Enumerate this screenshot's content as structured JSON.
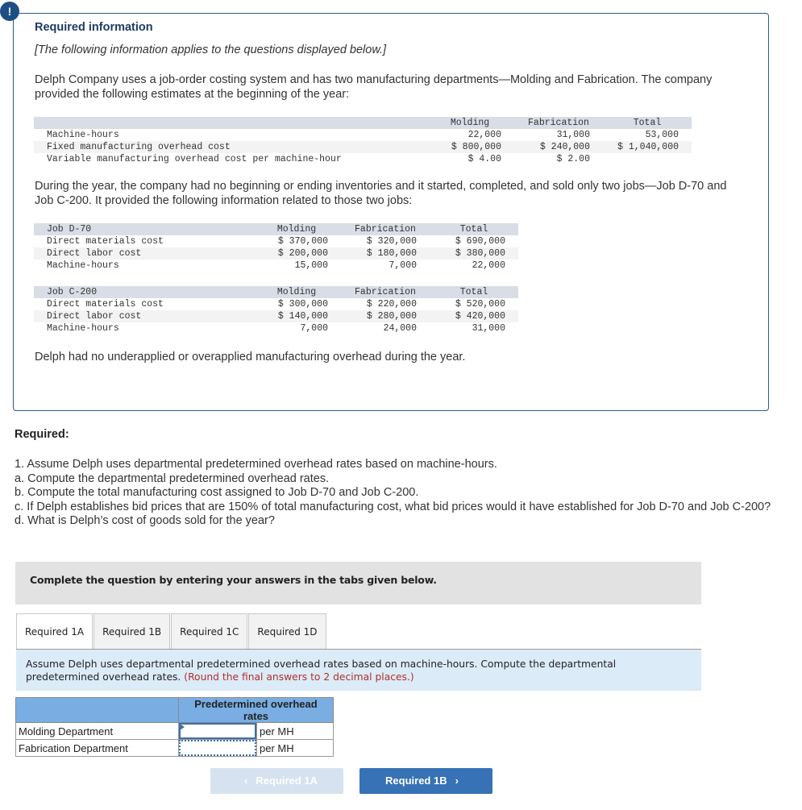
{
  "info": {
    "badge": "!",
    "title": "Required information",
    "italic_note": "[The following information applies to the questions displayed below.]",
    "intro": "Delph Company uses a job-order costing system and has two manufacturing departments—Molding and Fabrication. The company provided the following estimates at the beginning of the year:",
    "estimates": {
      "headers": [
        "",
        "Molding",
        "Fabrication",
        "Total"
      ],
      "rows": [
        {
          "label": "Machine-hours",
          "molding": "22,000",
          "fabrication": "31,000",
          "total": "53,000"
        },
        {
          "label": "Fixed manufacturing overhead cost",
          "molding": "$ 800,000",
          "fabrication": "$ 240,000",
          "total": "$ 1,040,000"
        },
        {
          "label": "Variable manufacturing overhead cost per machine-hour",
          "molding": "$ 4.00",
          "fabrication": "$ 2.00",
          "total": ""
        }
      ]
    },
    "jobs_intro": "During the year, the company had no beginning or ending inventories and it started, completed, and sold only two jobs—Job D-70 and Job C-200. It provided the following information related to those two jobs:",
    "job_d70": {
      "headers": [
        "Job D-70",
        "Molding",
        "Fabrication",
        "Total"
      ],
      "rows": [
        {
          "label": "Direct materials cost",
          "molding": "$ 370,000",
          "fabrication": "$ 320,000",
          "total": "$ 690,000"
        },
        {
          "label": "Direct labor cost",
          "molding": "$ 200,000",
          "fabrication": "$ 180,000",
          "total": "$ 380,000"
        },
        {
          "label": "Machine-hours",
          "molding": "15,000",
          "fabrication": "7,000",
          "total": "22,000"
        }
      ]
    },
    "job_c200": {
      "headers": [
        "Job C-200",
        "Molding",
        "Fabrication",
        "Total"
      ],
      "rows": [
        {
          "label": "Direct materials cost",
          "molding": "$ 300,000",
          "fabrication": "$ 220,000",
          "total": "$ 520,000"
        },
        {
          "label": "Direct labor cost",
          "molding": "$ 140,000",
          "fabrication": "$ 280,000",
          "total": "$ 420,000"
        },
        {
          "label": "Machine-hours",
          "molding": "7,000",
          "fabrication": "24,000",
          "total": "31,000"
        }
      ]
    },
    "closing": "Delph had no underapplied or overapplied manufacturing overhead during the year."
  },
  "required": {
    "heading": "Required:",
    "items": [
      "1. Assume Delph uses departmental predetermined overhead rates based on machine-hours.",
      "a. Compute the departmental predetermined overhead rates.",
      "b. Compute the total manufacturing cost assigned to Job D-70 and Job C-200.",
      "c. If Delph establishes bid prices that are 150% of total manufacturing cost, what bid prices would it have established for Job D-70 and Job C-200?",
      "d. What is Delph’s cost of goods sold for the year?"
    ]
  },
  "instruction": "Complete the question by entering your answers in the tabs given below.",
  "tabs": [
    {
      "label": "Required 1A",
      "active": true
    },
    {
      "label": "Required 1B",
      "active": false
    },
    {
      "label": "Required 1C",
      "active": false
    },
    {
      "label": "Required 1D",
      "active": false
    }
  ],
  "prompt": {
    "text": "Assume Delph uses departmental predetermined overhead rates based on machine-hours. Compute the departmental predetermined overhead rates.",
    "note": "(Round the final answers to 2 decimal places.)"
  },
  "answer_table": {
    "header": "Predetermined overhead rates",
    "rows": [
      {
        "label": "Molding Department",
        "value": "",
        "unit": "per MH"
      },
      {
        "label": "Fabrication Department",
        "value": "",
        "unit": "per MH"
      }
    ]
  },
  "nav": {
    "prev_label": "Required 1A",
    "next_label": "Required 1B",
    "prev_icon": "chevron-left-icon",
    "next_icon": "chevron-right-icon"
  },
  "colors": {
    "accent": "#1d4f86",
    "table_header": "#7aaee3",
    "prompt_bg": "#dcebf8",
    "note_red": "#b0302a",
    "next_button": "#3672b5"
  }
}
